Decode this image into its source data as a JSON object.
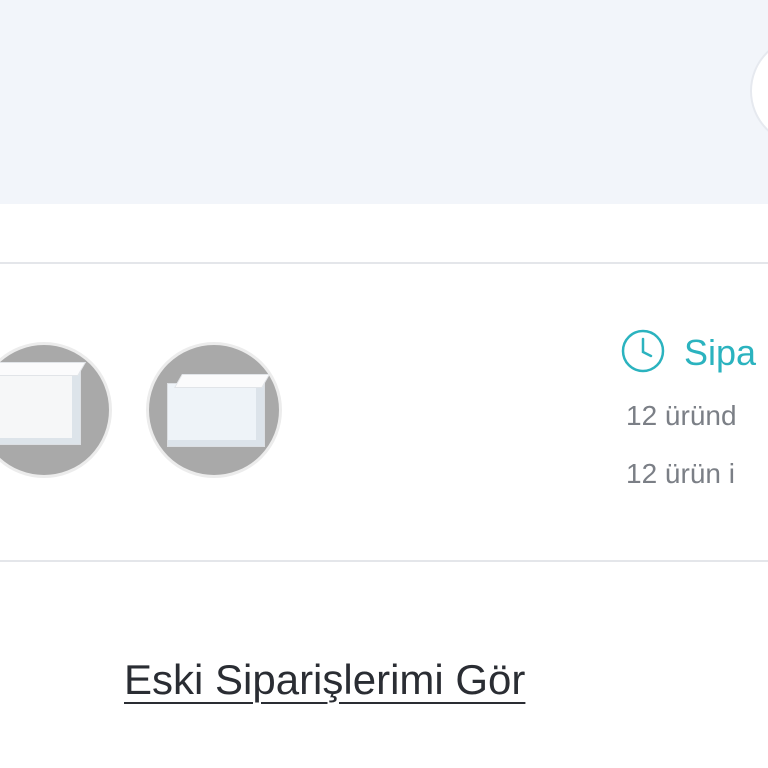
{
  "order": {
    "status_title": "Sipa",
    "line_1": "12 üründ",
    "line_2": "12 ürün i",
    "status_color": "#2bb3bf",
    "thumbnails": [
      {
        "icon": "product-image"
      },
      {
        "icon": "product-image"
      }
    ],
    "status_icon": "clock-icon"
  },
  "links": {
    "old_orders": "Eski Siparişlerimi Gör"
  },
  "colors": {
    "banner_bg": "#f2f5fa",
    "divider": "#e4e6ea",
    "accent": "#2bb3bf",
    "muted_text": "#7b7f86",
    "link_text": "#2a2d33"
  }
}
